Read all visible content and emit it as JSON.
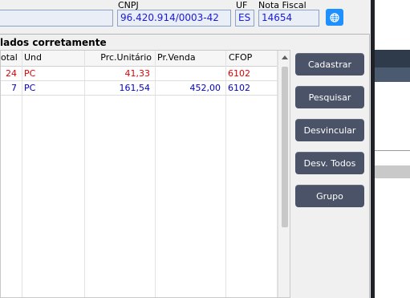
{
  "header": {
    "cnpj_label": "CNPJ",
    "cnpj_value": "96.420.914/0003-42",
    "uf_label": "UF",
    "uf_value": "ES",
    "nf_label": "Nota Fiscal",
    "nf_value": "14654"
  },
  "panel": {
    "title": "lados corretamente"
  },
  "table": {
    "columns": [
      "otal",
      "Und",
      "Prc.Unitário",
      "Pr.Venda",
      "CFOP"
    ],
    "rows": [
      {
        "total": "24",
        "und": "PC",
        "prc_unitario": "41,33",
        "pr_venda": "",
        "cfop": "6102",
        "color": "#e00000"
      },
      {
        "total": "7",
        "und": "PC",
        "prc_unitario": "161,54",
        "pr_venda": "452,00",
        "cfop": "6102",
        "color": "#0000c8"
      }
    ]
  },
  "actions": {
    "cadastrar": "Cadastrar",
    "pesquisar": "Pesquisar",
    "desvincular": "Desvincular",
    "desv_todos": "Desv. Todos",
    "grupo": "Grupo"
  },
  "colors": {
    "button_bg": "#4a5367",
    "accent": "#1e90ff",
    "field_text": "#1a1adc"
  }
}
